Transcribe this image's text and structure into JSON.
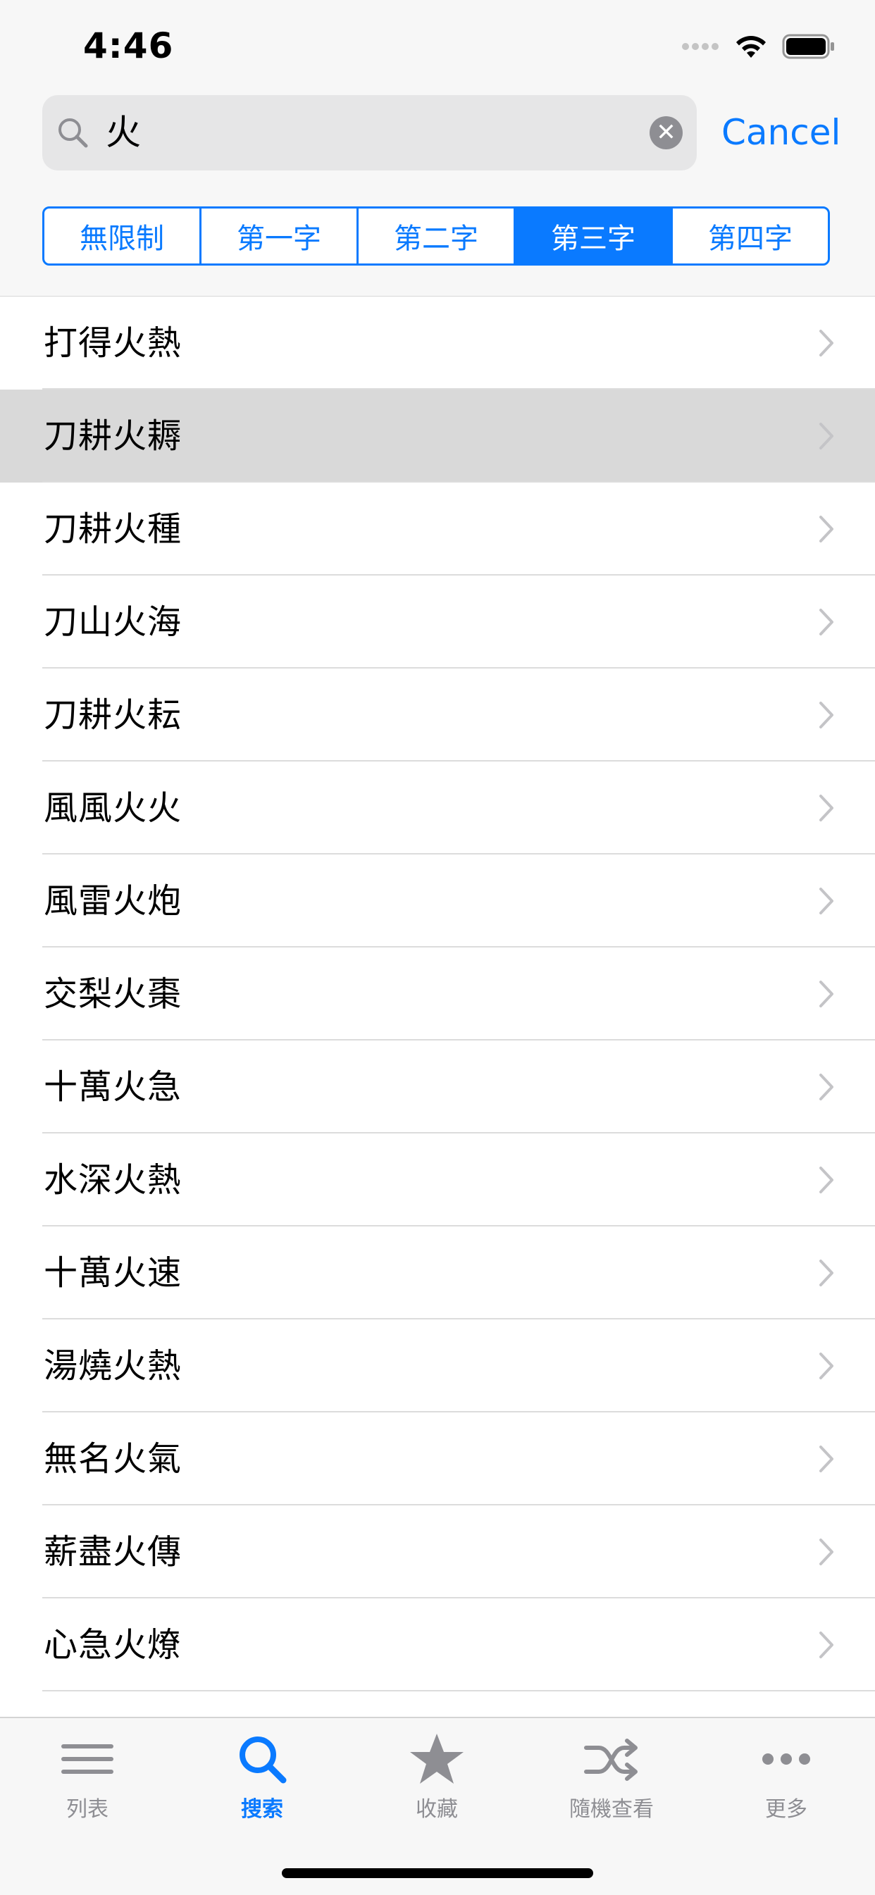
{
  "status_bar": {
    "time": "4:46"
  },
  "search": {
    "value": "火",
    "cancel_label": "Cancel"
  },
  "segments": [
    {
      "label": "無限制",
      "selected": false
    },
    {
      "label": "第一字",
      "selected": false
    },
    {
      "label": "第二字",
      "selected": false
    },
    {
      "label": "第三字",
      "selected": true
    },
    {
      "label": "第四字",
      "selected": false
    }
  ],
  "results": [
    "打得火熱",
    "刀耕火耨",
    "刀耕火種",
    "刀山火海",
    "刀耕火耘",
    "風風火火",
    "風雷火炮",
    "交梨火棗",
    "十萬火急",
    "水深火熱",
    "十萬火速",
    "湯燒火熱",
    "無名火氣",
    "薪盡火傳",
    "心急火燎"
  ],
  "highlighted_row": 1,
  "tabbar": {
    "items": [
      {
        "label": "列表",
        "icon": "list-icon",
        "active": false
      },
      {
        "label": "搜索",
        "icon": "search-icon",
        "active": true
      },
      {
        "label": "收藏",
        "icon": "star-icon",
        "active": false
      },
      {
        "label": "隨機查看",
        "icon": "shuffle-icon",
        "active": false
      },
      {
        "label": "更多",
        "icon": "more-icon",
        "active": false
      }
    ]
  },
  "colors": {
    "accent": "#0a7aff",
    "inactive": "#8e8e93",
    "highlight": "#d9d9d9"
  }
}
